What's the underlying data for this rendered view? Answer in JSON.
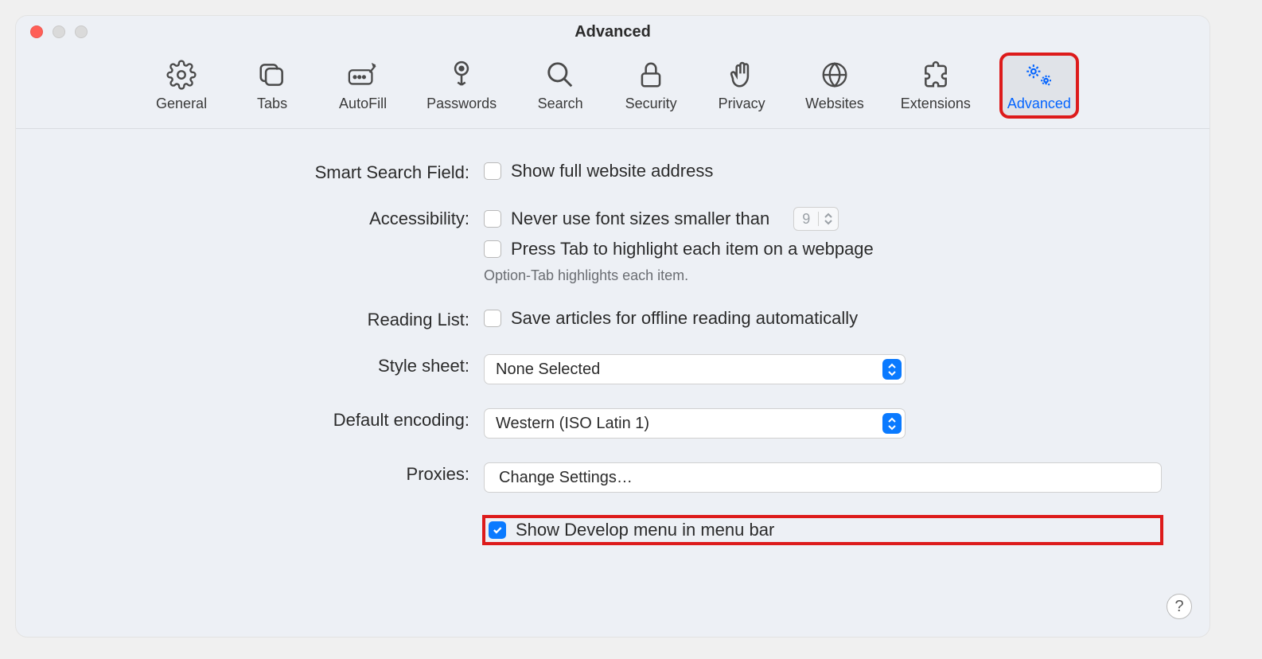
{
  "window": {
    "title": "Advanced"
  },
  "toolbar": {
    "items": [
      {
        "label": "General"
      },
      {
        "label": "Tabs"
      },
      {
        "label": "AutoFill"
      },
      {
        "label": "Passwords"
      },
      {
        "label": "Search"
      },
      {
        "label": "Security"
      },
      {
        "label": "Privacy"
      },
      {
        "label": "Websites"
      },
      {
        "label": "Extensions"
      },
      {
        "label": "Advanced"
      }
    ],
    "activeIndex": 9
  },
  "settings": {
    "smartSearch": {
      "label": "Smart Search Field:",
      "opt": "Show full website address",
      "checked": false
    },
    "accessibility": {
      "label": "Accessibility:",
      "fontOpt": "Never use font sizes smaller than",
      "fontChecked": false,
      "fontValue": "9",
      "tabOpt": "Press Tab to highlight each item on a webpage",
      "tabChecked": false,
      "hint": "Option-Tab highlights each item."
    },
    "readingList": {
      "label": "Reading List:",
      "opt": "Save articles for offline reading automatically",
      "checked": false
    },
    "styleSheet": {
      "label": "Style sheet:",
      "value": "None Selected"
    },
    "encoding": {
      "label": "Default encoding:",
      "value": "Western (ISO Latin 1)"
    },
    "proxies": {
      "label": "Proxies:",
      "button": "Change Settings…"
    },
    "develop": {
      "label": "Show Develop menu in menu bar",
      "checked": true
    }
  },
  "help": "?"
}
